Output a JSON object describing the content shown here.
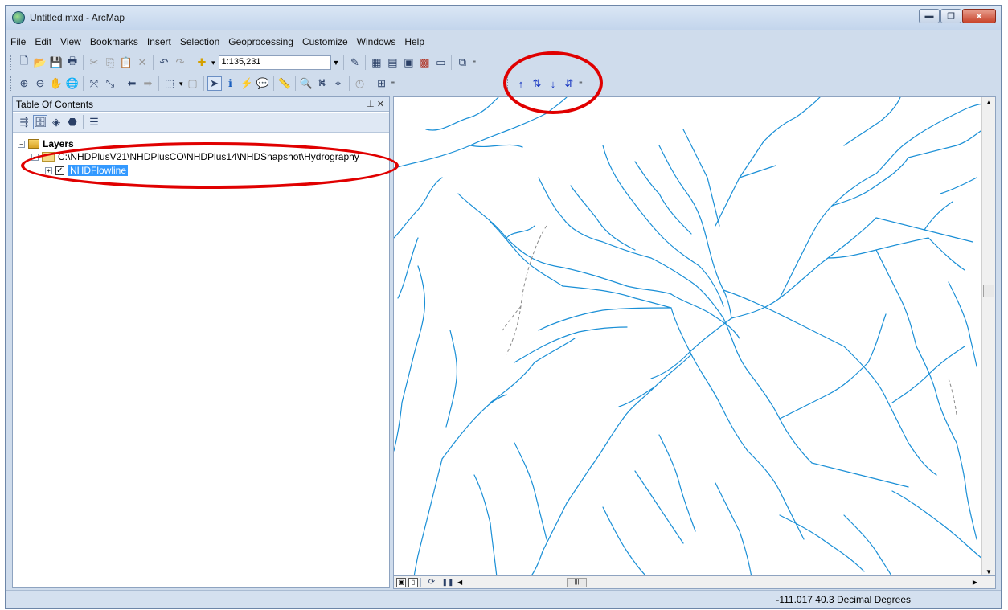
{
  "window": {
    "title": "Untitled.mxd - ArcMap"
  },
  "menu": [
    "File",
    "Edit",
    "View",
    "Bookmarks",
    "Insert",
    "Selection",
    "Geoprocessing",
    "Customize",
    "Windows",
    "Help"
  ],
  "toolbar": {
    "scale": "1:135,231"
  },
  "toc": {
    "title": "Table Of Contents",
    "pin_label": "&#x2B7; ×",
    "root": "Layers",
    "path": "C:\\NHDPlusV21\\NHDPlusCO\\NHDPlus14\\NHDSnapshot\\Hydrography",
    "layer": "NHDFlowline"
  },
  "status": {
    "coords": "-111.017  40.3 Decimal Degrees"
  },
  "colors": {
    "river": "#1a8fd6",
    "annotation": "#e00000",
    "selection": "#3399ff"
  }
}
